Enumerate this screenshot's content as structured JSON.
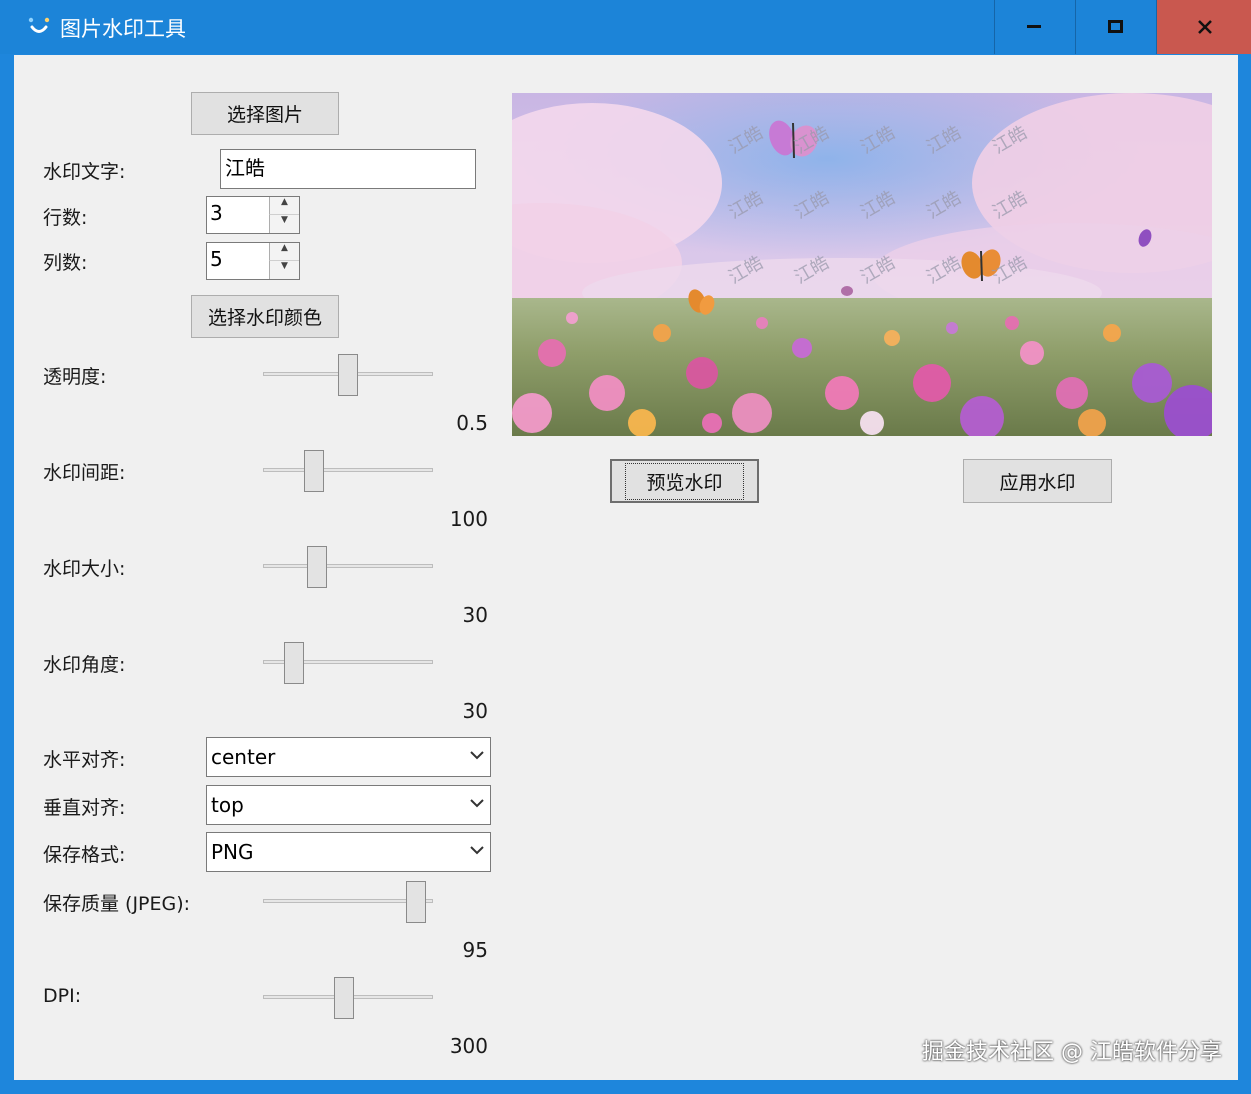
{
  "window": {
    "title": "图片水印工具",
    "minimize_icon": "minimize-icon",
    "maximize_icon": "maximize-icon",
    "close_icon": "close-icon"
  },
  "controls": {
    "select_image_label": "选择图片",
    "watermark_text_label": "水印文字:",
    "watermark_text_value": "江皓",
    "rows_label": "行数:",
    "rows_value": "3",
    "cols_label": "列数:",
    "cols_value": "5",
    "select_color_label": "选择水印颜色",
    "opacity_label": "透明度:",
    "opacity_value": "0.5",
    "spacing_label": "水印间距:",
    "spacing_value": "100",
    "size_label": "水印大小:",
    "size_value": "30",
    "angle_label": "水印角度:",
    "angle_value": "30",
    "h_align_label": "水平对齐:",
    "h_align_value": "center",
    "v_align_label": "垂直对齐:",
    "v_align_value": "top",
    "format_label": "保存格式:",
    "format_value": "PNG",
    "quality_label": "保存质量 (JPEG):",
    "quality_value": "95",
    "dpi_label": "DPI:",
    "dpi_value": "300"
  },
  "sliders": {
    "opacity": 0.5,
    "spacing": 0.27,
    "size": 0.29,
    "angle": 0.14,
    "quality": 0.95,
    "dpi": 0.47
  },
  "actions": {
    "preview_label": "预览水印",
    "apply_label": "应用水印"
  },
  "preview": {
    "watermark_text": "江皓",
    "image_description_icon": "flower-field-butterflies-image"
  },
  "footer": {
    "credit": "掘金技术社区 @ 江皓软件分享"
  },
  "colors": {
    "titlebar": "#1c84d8",
    "close_button": "#c9584f",
    "client_bg": "#f0f0f0"
  }
}
